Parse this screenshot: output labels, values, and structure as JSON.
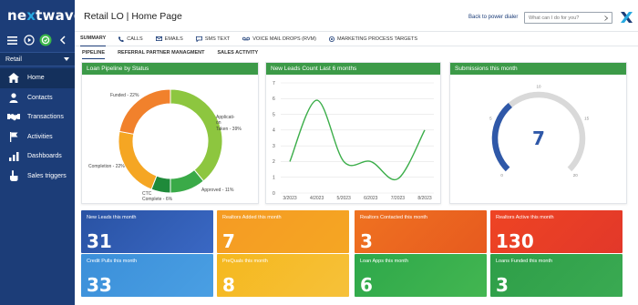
{
  "brand": {
    "logo_prefix": "ne",
    "logo_x": "x",
    "logo_suffix": "twave"
  },
  "sidebar": {
    "selected_team": "Retail",
    "items": [
      {
        "label": "Home",
        "icon": "home-icon",
        "active": true
      },
      {
        "label": "Contacts",
        "icon": "person-icon"
      },
      {
        "label": "Transactions",
        "icon": "handshake-icon"
      },
      {
        "label": "Activities",
        "icon": "flag-icon"
      },
      {
        "label": "Dashboards",
        "icon": "bar-chart-icon"
      },
      {
        "label": "Sales triggers",
        "icon": "pointer-hand-icon"
      }
    ]
  },
  "header": {
    "title": "Retail LO | Home Page",
    "back_link": "Back to power dialer",
    "search_placeholder": "What can I do for you?"
  },
  "tabs": [
    {
      "label": "SUMMARY",
      "icon": "",
      "active": true
    },
    {
      "label": "CALLS",
      "icon": "phone-icon"
    },
    {
      "label": "EMAILS",
      "icon": "mail-icon"
    },
    {
      "label": "SMS TEXT",
      "icon": "sms-icon"
    },
    {
      "label": "VOICE MAIL DROPS (RVM)",
      "icon": "voicemail-icon"
    },
    {
      "label": "MARKETING PROCESS TARGETS",
      "icon": "target-icon"
    }
  ],
  "subtabs": [
    {
      "label": "PIPELINE",
      "active": true
    },
    {
      "label": "REFERRAL PARTNER MANAGMENT"
    },
    {
      "label": "SALES ACTIVITY"
    }
  ],
  "panels": {
    "pipeline_title": "Loan Pipeline by Status",
    "leads_title": "New Leads Count Last 6 months",
    "submissions_title": "Submissions this month"
  },
  "chart_data": [
    {
      "type": "pie",
      "title": "Loan Pipeline by Status",
      "categories": [
        "Application Taken",
        "Approved",
        "CTC Complete",
        "Completion",
        "Funded"
      ],
      "labels": [
        "Application Taken - 39%",
        "Approved - 11%",
        "CTC Complete - 6%",
        "Completion - 22%",
        "Funded - 22%"
      ],
      "values": [
        39,
        11,
        6,
        22,
        22
      ],
      "colors": [
        "#8dc63f",
        "#3aaa48",
        "#1f8a3a",
        "#f5a623",
        "#f1812c"
      ]
    },
    {
      "type": "line",
      "title": "New Leads Count Last 6 months",
      "x": [
        "3/2023",
        "4/2023",
        "5/2023",
        "6/2023",
        "7/2023",
        "8/2023"
      ],
      "values": [
        2.0,
        5.9,
        2.0,
        2.0,
        0.9,
        4.0
      ],
      "ylim": [
        0,
        7
      ],
      "yticks": [
        0,
        1,
        2,
        3,
        4,
        5,
        6,
        7
      ],
      "color": "#3cae4a",
      "grid": true
    },
    {
      "type": "gauge",
      "title": "Submissions this month",
      "value": 7,
      "range": [
        0,
        20
      ],
      "tick_labels": [
        "0",
        "5",
        "10",
        "15",
        "20"
      ],
      "fill_color": "#2f58a8",
      "track_color": "#d9d9d9"
    }
  ],
  "tiles": [
    {
      "id": "new-leads",
      "label": "New Leads this month",
      "value": "31"
    },
    {
      "id": "realtors-added",
      "label": "Realtors Added this month",
      "value": "7"
    },
    {
      "id": "realtors-contacted",
      "label": "Realtors Contacted this month",
      "value": "3"
    },
    {
      "id": "realtors-active",
      "label": "Realtors Active this month",
      "value": "130"
    },
    {
      "id": "credit-pulls",
      "label": "Credit Pulls this month",
      "value": "33"
    },
    {
      "id": "prequals",
      "label": "PreQuals this month",
      "value": "8"
    },
    {
      "id": "loan-apps",
      "label": "Loan Apps this month",
      "value": "6"
    },
    {
      "id": "loans-funded",
      "label": "Loans Funded this month",
      "value": "3"
    }
  ]
}
